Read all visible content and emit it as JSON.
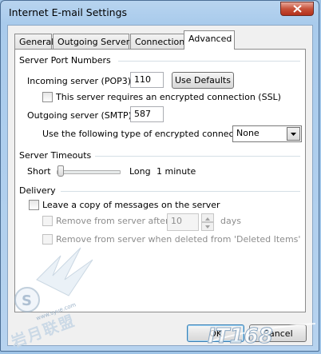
{
  "window": {
    "title": "Internet E-mail Settings"
  },
  "tabs": [
    {
      "label": "General",
      "active": false
    },
    {
      "label": "Outgoing Server",
      "active": false
    },
    {
      "label": "Connection",
      "active": false
    },
    {
      "label": "Advanced",
      "active": true
    }
  ],
  "port_group": {
    "title": "Server Port Numbers",
    "incoming_label": "Incoming server (POP3):",
    "incoming_value": "110",
    "use_defaults_label": "Use Defaults",
    "ssl_label": "This server requires an encrypted connection (SSL)",
    "ssl_checked": false,
    "outgoing_label": "Outgoing server (SMTP):",
    "outgoing_value": "587",
    "encryption_label": "Use the following type of encrypted connection:",
    "encryption_value": "None"
  },
  "timeout_group": {
    "title": "Server Timeouts",
    "short_label": "Short",
    "long_label": "Long",
    "value_text": "1 minute",
    "slider_level": 0.07
  },
  "delivery_group": {
    "title": "Delivery",
    "leave_copy_label": "Leave a copy of messages on the server",
    "leave_copy_checked": false,
    "remove_after_label": "Remove from server after",
    "days_value": "10",
    "days_unit": "days",
    "remove_deleted_label": "Remove from server when deleted from 'Deleted Items'"
  },
  "footer": {
    "ok_label": "OK",
    "cancel_label": "Cancel"
  },
  "watermarks": {
    "left_text": "岩月联盟",
    "left_url": "www.syue.com",
    "right_text": "IT168"
  },
  "colors": {
    "frame": "#a9cbec",
    "close_button": "#c7523a",
    "disabled_text": "#8d8d8d",
    "ok_focus": "#3c7fb1"
  }
}
